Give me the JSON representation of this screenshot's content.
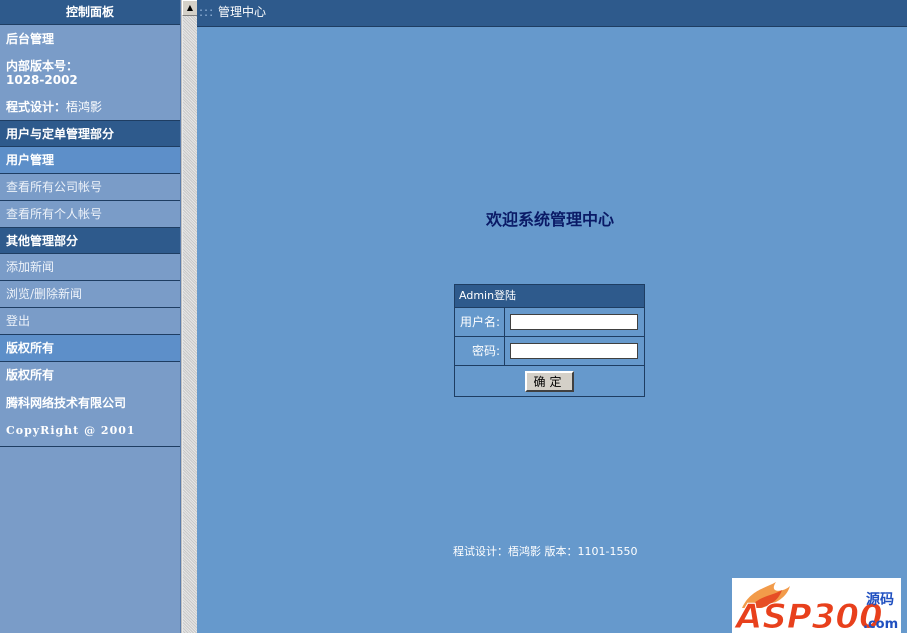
{
  "sidebar": {
    "title": "控制面板",
    "backend": "后台管理",
    "version_label": "内部版本号：",
    "version_value": "1028-2002",
    "designer_label": "程式设计：",
    "designer_name": "梧鸿影",
    "sections": [
      {
        "header": "用户与定单管理部分",
        "sub": "用户管理",
        "links": [
          "查看所有公司帐号",
          "查看所有个人帐号"
        ]
      },
      {
        "header": "其他管理部分",
        "links": [
          "添加新闻",
          "浏览/删除新闻",
          "登出"
        ]
      }
    ],
    "copyright": {
      "sub": "版权所有",
      "label": "版权所有",
      "company": "腾科网络技术有限公司",
      "notice": "CopyRight @ 2001"
    }
  },
  "scrollbar": {
    "up_arrow": "▲"
  },
  "topbar": {
    "prefix": ":::",
    "title": "管理中心"
  },
  "welcome": "欢迎系统管理中心",
  "login": {
    "title": "Admin登陆",
    "username_label": "用户名:",
    "password_label": "密码:",
    "username_value": "",
    "password_value": "",
    "submit_label": "确定"
  },
  "footer": "程试设计：梧鸿影 版本：1101-1550",
  "logo": {
    "text": "ASP300",
    "suffix": "源码",
    "domain": ".com"
  },
  "colors": {
    "page_bg": "#6699cc",
    "panel_dark": "#2e5a8c",
    "panel_light": "#7a9cc8",
    "highlight": "#5d8fc9",
    "welcome_text": "#0a1a66"
  }
}
